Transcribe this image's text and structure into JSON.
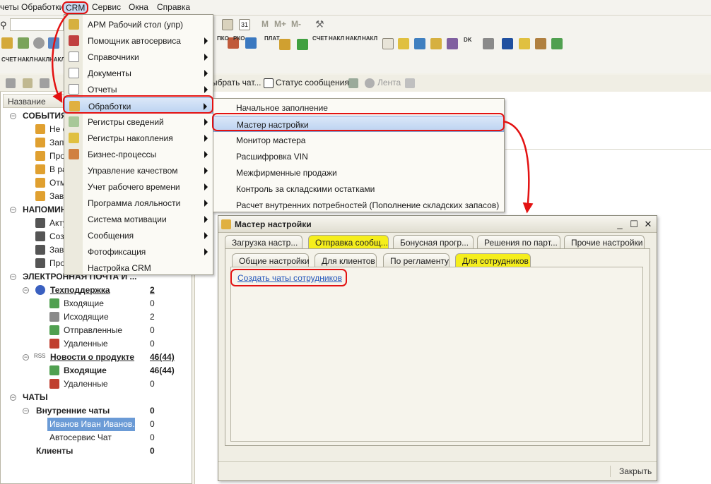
{
  "menubar": {
    "items": [
      "четы",
      "Обработки",
      "CRM",
      "Сервис",
      "Окна",
      "Справка"
    ]
  },
  "toolbar": {
    "mem_labels": [
      "M",
      "M+",
      "M-"
    ],
    "doc_labels": [
      "ПКО",
      "РКО",
      "ПЛАТ",
      "СЧЕТ",
      "НАКЛ",
      "НАКЛ",
      "СЧЕТ",
      "НАКЛ",
      "НАКЛ",
      "НАКЛ"
    ],
    "sigma_label": "DK",
    "calendar_label": "31"
  },
  "left_toolbar_row2": {
    "labels": [
      "СЧЕТ",
      "НАКЛ",
      "НАКЛ",
      "НАКЛ"
    ]
  },
  "main_toolbar": {
    "choose_chat": "ыбрать чат...",
    "message_status": "Статус сообщения",
    "feed": "Лента"
  },
  "tree": {
    "column_header": "Название",
    "events": {
      "label": "СОБЫТИЯ",
      "items": [
        "Не с",
        "Запл",
        "Про",
        "В ра",
        "Отм",
        "Зав"
      ]
    },
    "reminders": {
      "label": "НАПОМИН",
      "items": [
        "Акту",
        "Созд",
        "Заве",
        "Про"
      ]
    },
    "email": {
      "label": "ЭЛЕКТРОННАЯ ПОЧТА И ...",
      "support": {
        "label": "Техподдержка",
        "count": "2"
      },
      "support_items": [
        {
          "label": "Входящие",
          "count": "0"
        },
        {
          "label": "Исходящие",
          "count": "2"
        },
        {
          "label": "Отправленные",
          "count": "0"
        },
        {
          "label": "Удаленные",
          "count": "0"
        }
      ],
      "rss_tag": "RSS",
      "news": {
        "label": "Новости о продукте",
        "count": "46(44)"
      },
      "news_items": [
        {
          "label": "Входящие",
          "count": "46(44)"
        },
        {
          "label": "Удаленные",
          "count": "0"
        }
      ]
    },
    "chats": {
      "label": "ЧАТЫ",
      "internal": {
        "label": "Внутренние чаты",
        "count": "0"
      },
      "internal_items": [
        {
          "label": "Иванов Иван Иванов...",
          "count": "0"
        },
        {
          "label": "Автосервис Чат",
          "count": "0"
        }
      ],
      "clients": {
        "label": "Клиенты",
        "count": "0"
      }
    }
  },
  "crm_menu": {
    "items": [
      {
        "label": "АРМ Рабочий стол (упр)",
        "submenu": false
      },
      {
        "label": "Помощник автосервиса",
        "submenu": true
      },
      {
        "label": "Справочники",
        "submenu": true
      },
      {
        "label": "Документы",
        "submenu": true
      },
      {
        "label": "Отчеты",
        "submenu": true
      },
      {
        "label": "Обработки",
        "submenu": true
      },
      {
        "label": "Регистры сведений",
        "submenu": true
      },
      {
        "label": "Регистры накопления",
        "submenu": true
      },
      {
        "label": "Бизнес-процессы",
        "submenu": true
      },
      {
        "label": "Управление качеством",
        "submenu": true
      },
      {
        "label": "Учет рабочего времени",
        "submenu": true
      },
      {
        "label": "Программа лояльности",
        "submenu": true
      },
      {
        "label": "Система мотивации",
        "submenu": true
      },
      {
        "label": "Сообщения",
        "submenu": true
      },
      {
        "label": "Фотофиксация",
        "submenu": true
      },
      {
        "label": "Настройка CRM",
        "submenu": false
      }
    ]
  },
  "sub_menu": {
    "items": [
      "Начальное заполнение",
      "Мастер настройки",
      "Монитор мастера",
      "Расшифровка VIN",
      "Межфирменные продажи",
      "Контроль за складскими остатками",
      "Расчет внутренних потребностей (Пополнение складских запасов)"
    ]
  },
  "wizard": {
    "title": "Мастер настройки",
    "buttons": {
      "minimize": "_",
      "maximize": "☐",
      "close": "✕"
    },
    "tabs": [
      "Загрузка настр...",
      "Отправка сообщ...",
      "Бонусная прогр...",
      "Решения по парт...",
      "Прочие настройки"
    ],
    "subtabs": [
      "Общие настройки",
      "Для клиентов",
      "По регламенту",
      "Для сотрудников"
    ],
    "link": "Создать чаты сотрудников",
    "close_label": "Закрыть"
  },
  "colors": {
    "highlight_red": "#e31212",
    "active_tab_yellow": "#f5ee1c",
    "menu_highlight": "#bcd3f1",
    "selected_row": "#6b9bd6"
  }
}
